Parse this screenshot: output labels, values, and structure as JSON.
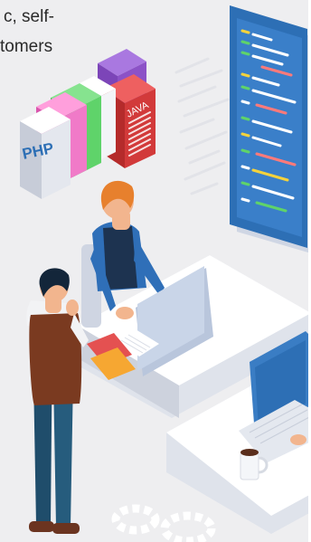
{
  "text_fragment": {
    "line1": "c, self-",
    "line2": "tomers"
  },
  "book_labels": {
    "php": "PHP",
    "java": "JAVA"
  },
  "colors": {
    "background": "#eeeef0",
    "monitor_blue": "#2d6fb5",
    "laptop_blue": "#3a7dc4",
    "shirt_blue": "#2f6fb8",
    "vest_navy": "#1d3350",
    "vest_brown": "#7a3a20",
    "hair_orange": "#e7802d",
    "book_purple": "#8c52c7",
    "book_red": "#d23a3a",
    "book_green": "#5fd36a",
    "book_pink": "#f07ac8"
  }
}
